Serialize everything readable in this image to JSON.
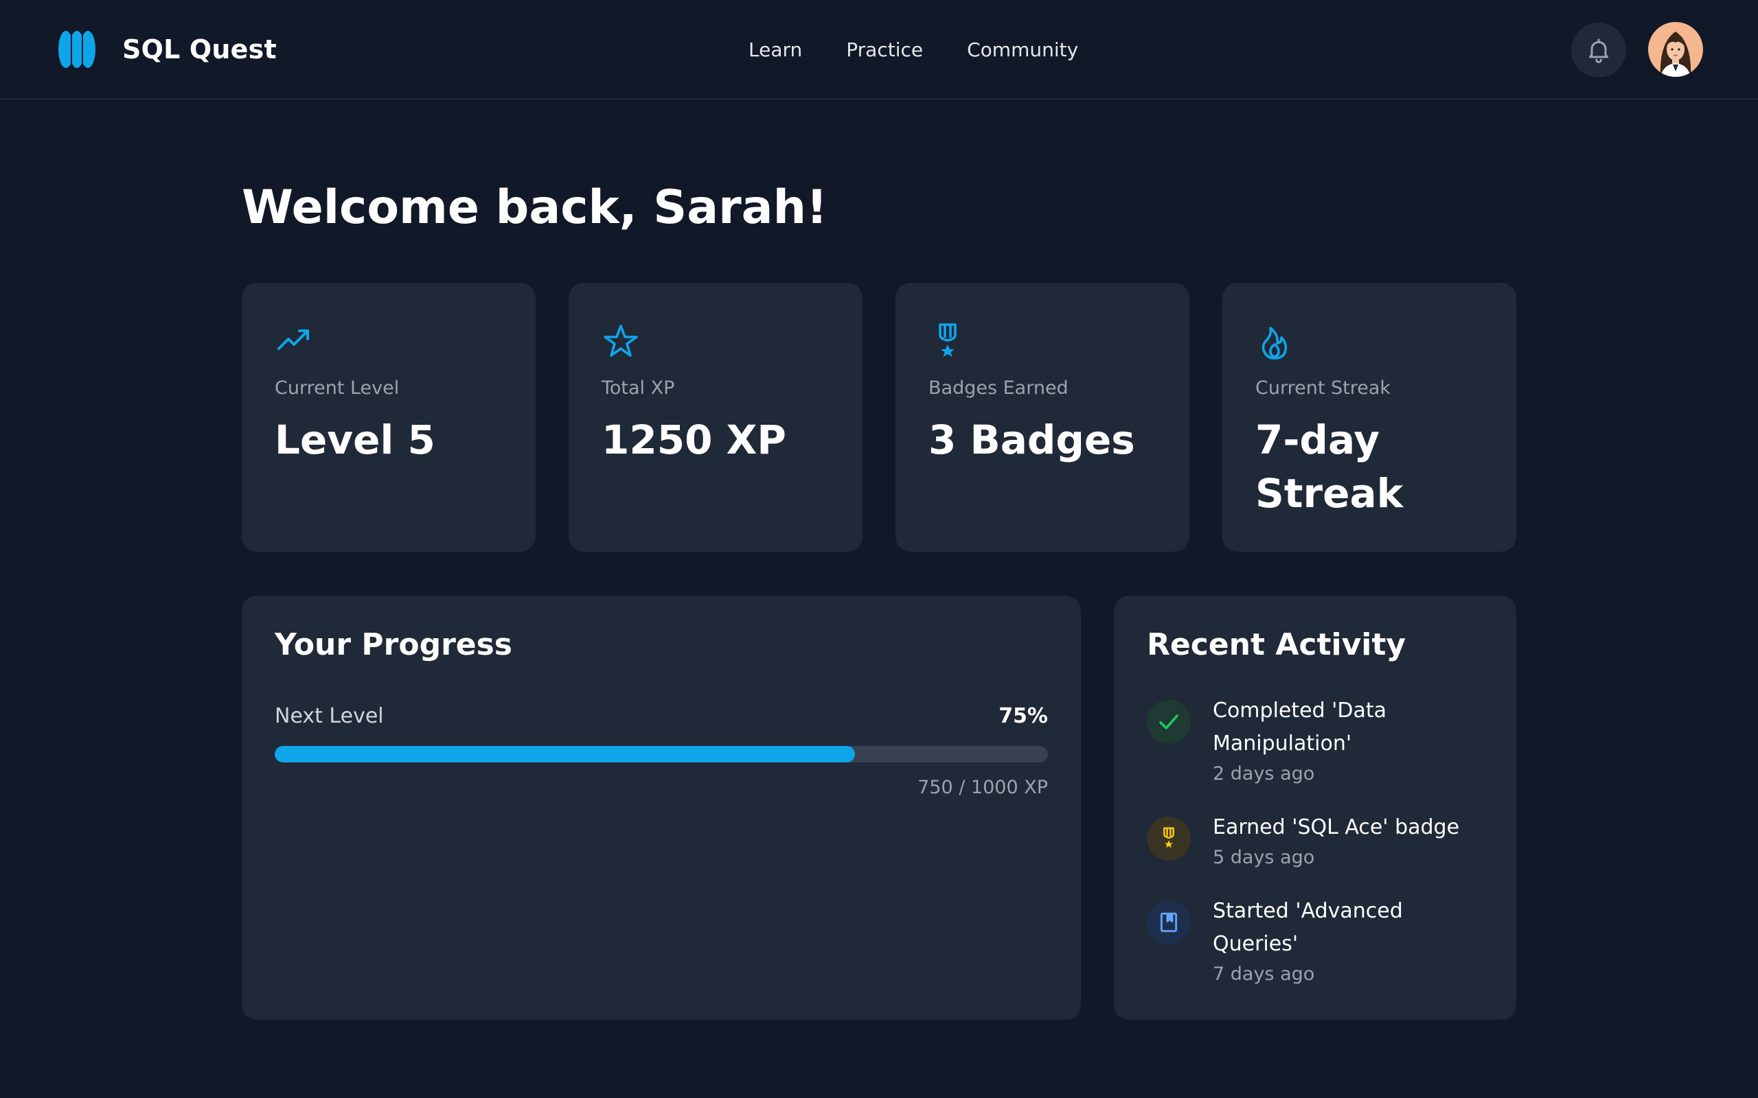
{
  "app": {
    "name": "SQL Quest"
  },
  "nav": {
    "items": [
      {
        "label": "Learn"
      },
      {
        "label": "Practice"
      },
      {
        "label": "Community"
      }
    ]
  },
  "header": {
    "notification_icon": "bell-icon",
    "avatar": "user-avatar"
  },
  "welcome": {
    "title": "Welcome back, Sarah!"
  },
  "stats": [
    {
      "icon": "trending-up-icon",
      "label": "Current Level",
      "value": "Level 5"
    },
    {
      "icon": "star-icon",
      "label": "Total XP",
      "value": "1250 XP"
    },
    {
      "icon": "medal-icon",
      "label": "Badges Earned",
      "value": "3 Badges"
    },
    {
      "icon": "flame-icon",
      "label": "Current Streak",
      "value": "7-day Streak"
    }
  ],
  "progress": {
    "title": "Your Progress",
    "label": "Next Level",
    "percent_text": "75%",
    "fraction": 0.75,
    "xp_text": "750 / 1000 XP"
  },
  "activity": {
    "title": "Recent Activity",
    "items": [
      {
        "icon": "check-icon",
        "title": "Completed 'Data Manipulation'",
        "time": "2 days ago"
      },
      {
        "icon": "medal-icon",
        "title": "Earned 'SQL Ace' badge",
        "time": "5 days ago"
      },
      {
        "icon": "book-icon",
        "title": "Started 'Advanced Queries'",
        "time": "7 days ago"
      }
    ]
  },
  "colors": {
    "background": "#111827",
    "card": "#1f2937",
    "accent": "#0ea5e9",
    "success": "#22c55e",
    "badge_gold": "#facc15",
    "book_blue": "#60a5fa"
  }
}
